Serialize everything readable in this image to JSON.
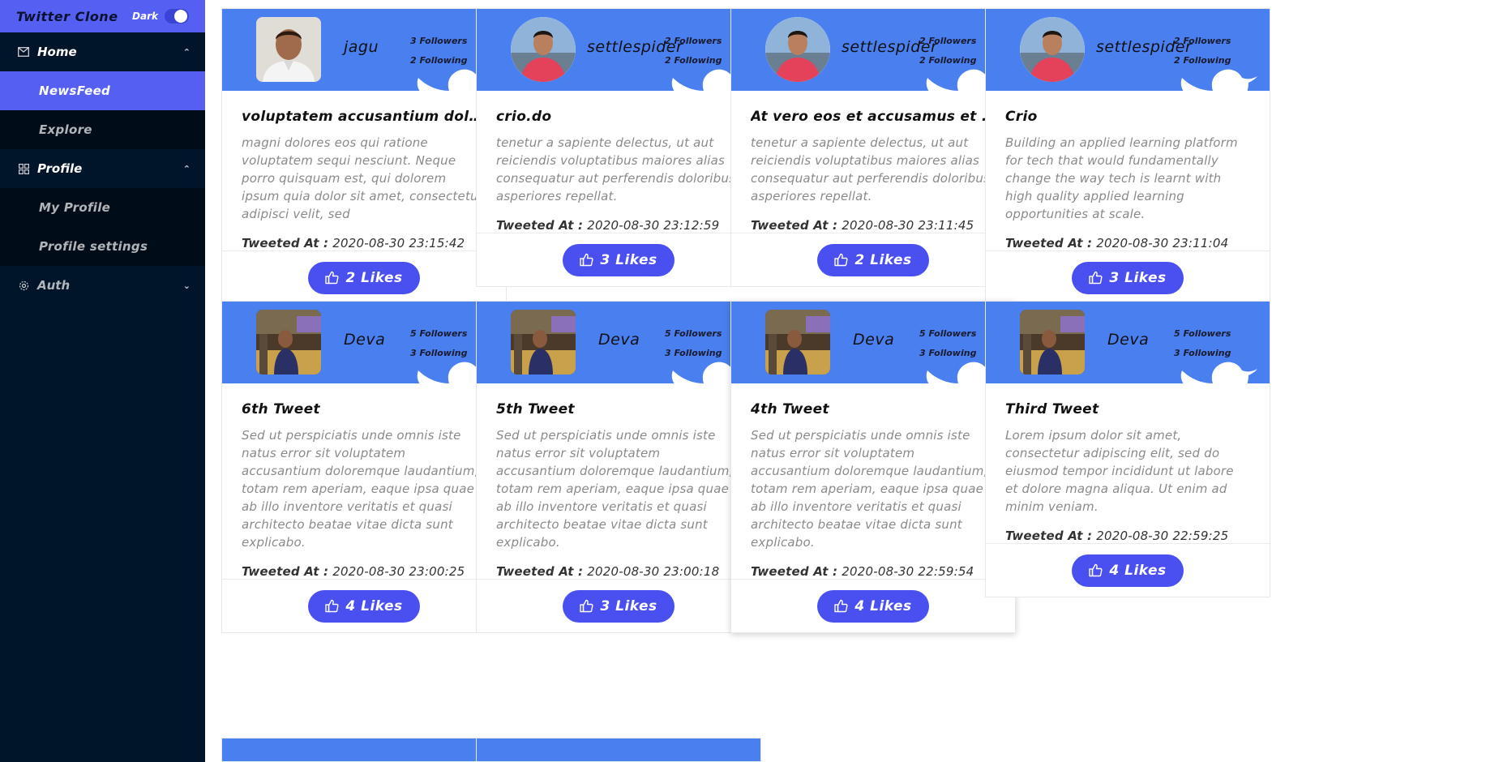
{
  "sidebar": {
    "app_title": "Twitter Clone",
    "dark_label": "Dark",
    "home_label": "Home",
    "newsfeed_label": "NewsFeed",
    "explore_label": "Explore",
    "profile_label": "Profile",
    "my_profile_label": "My Profile",
    "profile_settings_label": "Profile settings",
    "auth_label": "Auth"
  },
  "labels": {
    "tweeted_at": "Tweeted At :"
  },
  "tweets": [
    {
      "user": "jagu",
      "followers": "3 Followers",
      "following": "2 Following",
      "title": "voluptatem accusantium doloremque",
      "body": "magni dolores eos qui ratione voluptatem sequi nesciunt. Neque porro quisquam est, qui dolorem ipsum quia dolor sit amet, consectetur, adipisci velit, sed",
      "time": "2020-08-30 23:15:42",
      "likes": "2 Likes",
      "avatar": "person-photo"
    },
    {
      "user": "settlespider",
      "followers": "2 Followers",
      "following": "2 Following",
      "title": "crio.do",
      "body": "tenetur a sapiente delectus, ut aut reiciendis voluptatibus maiores alias consequatur aut perferendis doloribus asperiores repellat.",
      "time": "2020-08-30 23:12:59",
      "likes": "3 Likes",
      "avatar": "person-red-shirt"
    },
    {
      "user": "settlespider",
      "followers": "2 Followers",
      "following": "2 Following",
      "title": "At vero eos et accusamus et iusto odio",
      "body": "tenetur a sapiente delectus, ut aut reiciendis voluptatibus maiores alias consequatur aut perferendis doloribus asperiores repellat.",
      "time": "2020-08-30 23:11:45",
      "likes": "2 Likes",
      "avatar": "person-red-shirt"
    },
    {
      "user": "settlespider",
      "followers": "2 Followers",
      "following": "2 Following",
      "title": "Crio",
      "body": "Building an applied learning platform for tech that would fundamentally change the way tech is learnt with high quality applied learning opportunities at scale.",
      "time": "2020-08-30 23:11:04",
      "likes": "3 Likes",
      "avatar": "person-red-shirt"
    },
    {
      "user": "Deva",
      "followers": "5 Followers",
      "following": "3 Following",
      "title": "6th Tweet",
      "body": "Sed ut perspiciatis unde omnis iste natus error sit voluptatem accusantium doloremque laudantium, totam rem aperiam, eaque ipsa quae ab illo inventore veritatis et quasi architecto beatae vitae dicta sunt explicabo.",
      "time": "2020-08-30 23:00:25",
      "likes": "4 Likes",
      "avatar": "person-indoor"
    },
    {
      "user": "Deva",
      "followers": "5 Followers",
      "following": "3 Following",
      "title": "5th Tweet",
      "body": "Sed ut perspiciatis unde omnis iste natus error sit voluptatem accusantium doloremque laudantium, totam rem aperiam, eaque ipsa quae ab illo inventore veritatis et quasi architecto beatae vitae dicta sunt explicabo.",
      "time": "2020-08-30 23:00:18",
      "likes": "3 Likes",
      "avatar": "person-indoor"
    },
    {
      "user": "Deva",
      "followers": "5 Followers",
      "following": "3 Following",
      "title": "4th Tweet",
      "body": "Sed ut perspiciatis unde omnis iste natus error sit voluptatem accusantium doloremque laudantium, totam rem aperiam, eaque ipsa quae ab illo inventore veritatis et quasi architecto beatae vitae dicta sunt explicabo.",
      "time": "2020-08-30 22:59:54",
      "likes": "4 Likes",
      "avatar": "person-indoor"
    },
    {
      "user": "Deva",
      "followers": "5 Followers",
      "following": "3 Following",
      "title": "Third Tweet",
      "body": "Lorem ipsum dolor sit amet, consectetur adipiscing elit, sed do eiusmod tempor incididunt ut labore et dolore magna aliqua. Ut enim ad minim veniam.",
      "time": "2020-08-30 22:59:25",
      "likes": "4 Likes",
      "avatar": "person-indoor"
    }
  ],
  "colors": {
    "sidebar_bg": "#001529",
    "accent": "#5560f2",
    "card_header": "#4a7ff0",
    "like_button": "#4a4ff0"
  }
}
